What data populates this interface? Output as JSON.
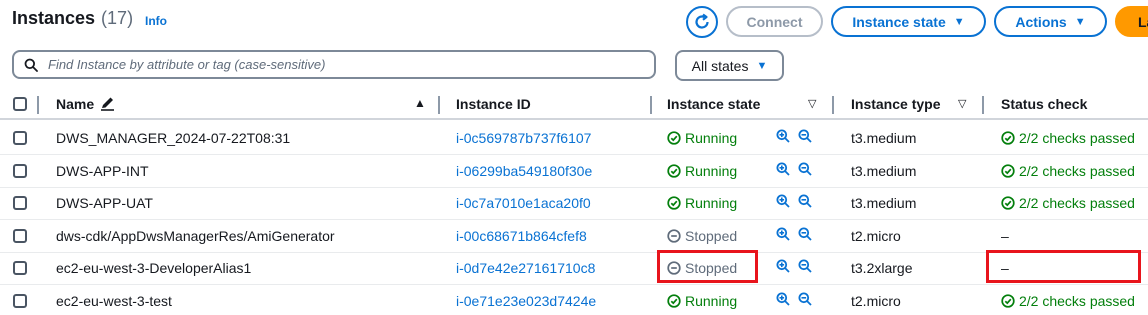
{
  "header": {
    "title": "Instances",
    "count": "(17)",
    "info_label": "Info",
    "connect_label": "Connect",
    "instance_state_label": "Instance state",
    "actions_label": "Actions",
    "launch_label": "La"
  },
  "search": {
    "placeholder": "Find Instance by attribute or tag (case-sensitive)"
  },
  "filter": {
    "selected": "All states"
  },
  "table": {
    "columns": {
      "name": "Name",
      "instance_id": "Instance ID",
      "instance_state": "Instance state",
      "instance_type": "Instance type",
      "status_check": "Status check"
    },
    "rows": [
      {
        "name": "DWS_MANAGER_2024-07-22T08:31",
        "id": "i-0c569787b737f6107",
        "state": "Running",
        "type": "t3.medium",
        "status": "2/2 checks passed"
      },
      {
        "name": "DWS-APP-INT",
        "id": "i-06299ba549180f30e",
        "state": "Running",
        "type": "t3.medium",
        "status": "2/2 checks passed"
      },
      {
        "name": "DWS-APP-UAT",
        "id": "i-0c7a7010e1aca20f0",
        "state": "Running",
        "type": "t3.medium",
        "status": "2/2 checks passed"
      },
      {
        "name": "dws-cdk/AppDwsManagerRes/AmiGenerator",
        "id": "i-00c68671b864cfef8",
        "state": "Stopped",
        "type": "t2.micro",
        "status": "–"
      },
      {
        "name": "ec2-eu-west-3-DeveloperAlias1",
        "id": "i-0d7e42e27161710c8",
        "state": "Stopped",
        "type": "t3.2xlarge",
        "status": "–"
      },
      {
        "name": "ec2-eu-west-3-test",
        "id": "i-0e71e23e023d7424e",
        "state": "Running",
        "type": "t2.micro",
        "status": "2/2 checks passed"
      }
    ]
  },
  "colors": {
    "link": "#0972d3",
    "success": "#037f0c",
    "stopped": "#5f6b7a",
    "launch": "#ff9900",
    "highlight": "#e8141c"
  }
}
